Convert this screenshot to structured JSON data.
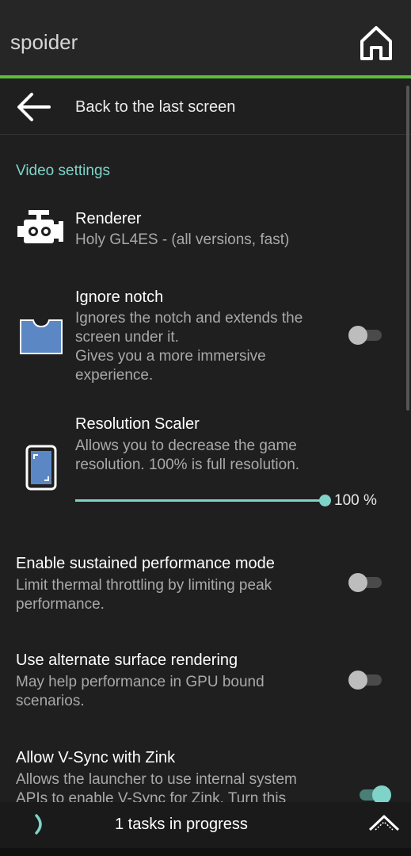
{
  "app": {
    "title": "spoider"
  },
  "colors": {
    "accent": "#7fd3c9",
    "bar_accent": "#5cbd3a",
    "background": "#1f1f1f"
  },
  "back": {
    "label": "Back to the last screen",
    "icon": "back-arrow-icon"
  },
  "section": {
    "title": "Video settings"
  },
  "renderer": {
    "title": "Renderer",
    "value": "Holy GL4ES - (all versions, fast)",
    "icon": "engine-icon"
  },
  "notch": {
    "title": "Ignore notch",
    "desc_1": "Ignores the notch and extends the",
    "desc_2": "screen under it.",
    "desc_3": "Gives you a more immersive",
    "desc_4": "experience.",
    "enabled": false,
    "icon": "notch-phone-icon"
  },
  "scaler": {
    "title": "Resolution Scaler",
    "desc_1": "Allows you to decrease the game",
    "desc_2": "resolution. 100% is full resolution.",
    "value_label": "100 %",
    "value": 100,
    "icon": "resize-phone-icon"
  },
  "sustained": {
    "title": "Enable sustained performance mode",
    "desc_1": "Limit thermal throttling by limiting peak",
    "desc_2": "performance.",
    "enabled": false
  },
  "surface": {
    "title": "Use alternate surface rendering",
    "desc_1": "May help performance in GPU bound",
    "desc_2": "scenarios.",
    "enabled": false
  },
  "vsync": {
    "title": "Allow V-Sync with Zink",
    "desc_1": "Allows the launcher to use internal system",
    "desc_2": "APIs to enable V-Sync for Zink. Turn this",
    "enabled": true
  },
  "bottom": {
    "status": "1 tasks in progress"
  }
}
